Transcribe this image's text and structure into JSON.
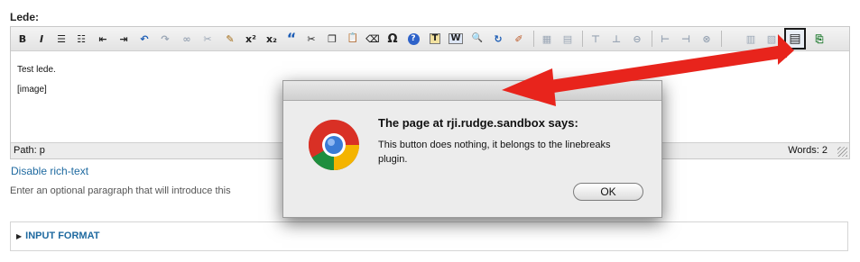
{
  "field": {
    "label": "Lede:"
  },
  "toolbar": {
    "buttons": [
      {
        "icon": "bold-icon",
        "glyph": "B"
      },
      {
        "icon": "italic-icon",
        "glyph": "I"
      },
      {
        "icon": "bullet-list-icon",
        "glyph": "☰"
      },
      {
        "icon": "numbered-list-icon",
        "glyph": "☷"
      },
      {
        "icon": "outdent-icon",
        "glyph": "⇤"
      },
      {
        "icon": "indent-icon",
        "glyph": "⇥"
      },
      {
        "icon": "undo-icon",
        "glyph": "↶"
      },
      {
        "icon": "redo-icon",
        "glyph": "↷"
      },
      {
        "icon": "link-icon",
        "glyph": "∞"
      },
      {
        "icon": "unlink-icon",
        "glyph": "✂"
      },
      {
        "icon": "cleanup-icon",
        "glyph": "✎"
      },
      {
        "icon": "superscript-icon",
        "glyph": "x²"
      },
      {
        "icon": "subscript-icon",
        "glyph": "x₂"
      },
      {
        "icon": "blockquote-icon",
        "glyph": "“"
      },
      {
        "icon": "cut-icon",
        "glyph": "✂"
      },
      {
        "icon": "copy-icon",
        "glyph": "❐"
      },
      {
        "icon": "paste-icon",
        "glyph": "📋"
      },
      {
        "icon": "eraser-icon",
        "glyph": "⌫"
      },
      {
        "icon": "special-char-icon",
        "glyph": "Ω"
      },
      {
        "icon": "help-icon",
        "glyph": "?"
      },
      {
        "icon": "paste-text-icon",
        "glyph": "T"
      },
      {
        "icon": "paste-word-icon",
        "glyph": "W"
      },
      {
        "icon": "find-icon",
        "glyph": "🔍"
      },
      {
        "icon": "replace-icon",
        "glyph": "↻"
      },
      {
        "icon": "edit-html-icon",
        "glyph": "✐"
      },
      {
        "icon": "table-icon",
        "glyph": "▦"
      },
      {
        "icon": "table-props-icon",
        "glyph": "▤"
      },
      {
        "icon": "row-before-icon",
        "glyph": "⊤"
      },
      {
        "icon": "row-after-icon",
        "glyph": "⊥"
      },
      {
        "icon": "delete-row-icon",
        "glyph": "⊖"
      },
      {
        "icon": "col-before-icon",
        "glyph": "⊢"
      },
      {
        "icon": "col-after-icon",
        "glyph": "⊣"
      },
      {
        "icon": "delete-col-icon",
        "glyph": "⊗"
      },
      {
        "icon": "split-cells-icon",
        "glyph": "▥"
      },
      {
        "icon": "merge-cells-icon",
        "glyph": "▧"
      },
      {
        "icon": "linebreaks-icon",
        "glyph": "▤"
      },
      {
        "icon": "export-icon",
        "glyph": "⎘"
      }
    ]
  },
  "editor": {
    "lines": [
      "Test lede.",
      "[image]"
    ],
    "path_label": "Path: p",
    "word_count": "Words: 2"
  },
  "disable_link": "Disable rich-text",
  "description": "Enter an optional paragraph that will introduce this",
  "input_format": {
    "legend": "INPUT FORMAT"
  },
  "dialog": {
    "title": "The page at rji.rudge.sandbox says:",
    "message": "This button does nothing, it belongs to the linebreaks plugin.",
    "ok_label": "OK",
    "icon": "chrome-logo-icon"
  },
  "colors": {
    "accent_link": "#1f6aa0",
    "annotation_arrow": "#e8241c"
  }
}
